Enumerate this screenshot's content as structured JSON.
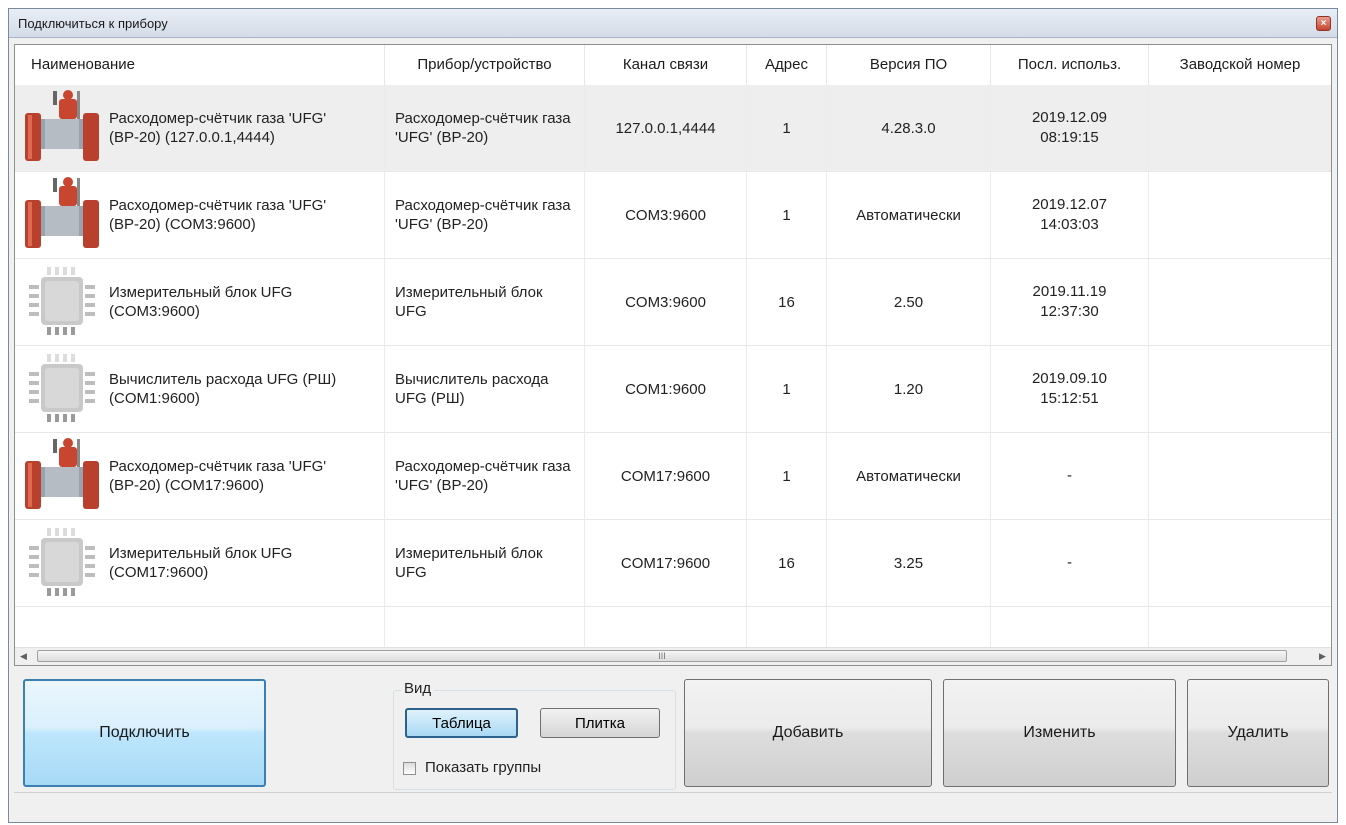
{
  "window": {
    "title": "Подключиться к прибору",
    "close_label": "×"
  },
  "table": {
    "columns": [
      "Наименование",
      "Прибор/устройство",
      "Канал связи",
      "Адрес",
      "Версия ПО",
      "Посл. использ.",
      "Заводской номер"
    ],
    "rows": [
      {
        "icon": "flowmeter-icon",
        "name": "Расходомер-счётчик газа 'UFG' (ВР-20) (127.0.0.1,4444)",
        "device": "Расходомер-счётчик газа 'UFG' (ВР-20)",
        "channel": "127.0.0.1,4444",
        "address": "1",
        "version": "4.28.3.0",
        "last_used_date": "2019.12.09",
        "last_used_time": "08:19:15",
        "serial": "",
        "selected": true
      },
      {
        "icon": "flowmeter-icon",
        "name": "Расходомер-счётчик газа 'UFG' (ВР-20) (COM3:9600)",
        "device": "Расходомер-счётчик газа 'UFG' (ВР-20)",
        "channel": "COM3:9600",
        "address": "1",
        "version": "Автоматически",
        "last_used_date": "2019.12.07",
        "last_used_time": "14:03:03",
        "serial": "",
        "selected": false
      },
      {
        "icon": "chip-icon",
        "name": "Измерительный блок UFG (COM3:9600)",
        "device": "Измерительный блок UFG",
        "channel": "COM3:9600",
        "address": "16",
        "version": "2.50",
        "last_used_date": "2019.11.19",
        "last_used_time": "12:37:30",
        "serial": "",
        "selected": false
      },
      {
        "icon": "chip-icon",
        "name": "Вычислитель расхода UFG (РШ) (COM1:9600)",
        "device": "Вычислитель расхода UFG (РШ)",
        "channel": "COM1:9600",
        "address": "1",
        "version": "1.20",
        "last_used_date": "2019.09.10",
        "last_used_time": "15:12:51",
        "serial": "",
        "selected": false
      },
      {
        "icon": "flowmeter-icon",
        "name": "Расходомер-счётчик газа 'UFG' (ВР-20) (COM17:9600)",
        "device": "Расходомер-счётчик газа 'UFG' (ВР-20)",
        "channel": "COM17:9600",
        "address": "1",
        "version": "Автоматически",
        "last_used_date": "-",
        "last_used_time": "",
        "serial": "",
        "selected": false
      },
      {
        "icon": "chip-icon",
        "name": "Измерительный блок UFG (COM17:9600)",
        "device": "Измерительный блок UFG",
        "channel": "COM17:9600",
        "address": "16",
        "version": "3.25",
        "last_used_date": "-",
        "last_used_time": "",
        "serial": "",
        "selected": false
      }
    ]
  },
  "scrollbar": {
    "left_arrow": "◀",
    "right_arrow": "▶",
    "grip": "III"
  },
  "buttons": {
    "connect": "Подключить",
    "add": "Добавить",
    "edit": "Изменить",
    "delete": "Удалить"
  },
  "view_group": {
    "label": "Вид",
    "table_label": "Таблица",
    "tile_label": "Плитка",
    "selected": "Таблица",
    "show_groups_label": "Показать группы",
    "show_groups_checked": false
  },
  "colors": {
    "flowmeter_body": "#c8462f",
    "flowmeter_flange": "#b8402c",
    "chip_body": "#c9c9c9",
    "selected_button_border": "#3c7fb1"
  }
}
